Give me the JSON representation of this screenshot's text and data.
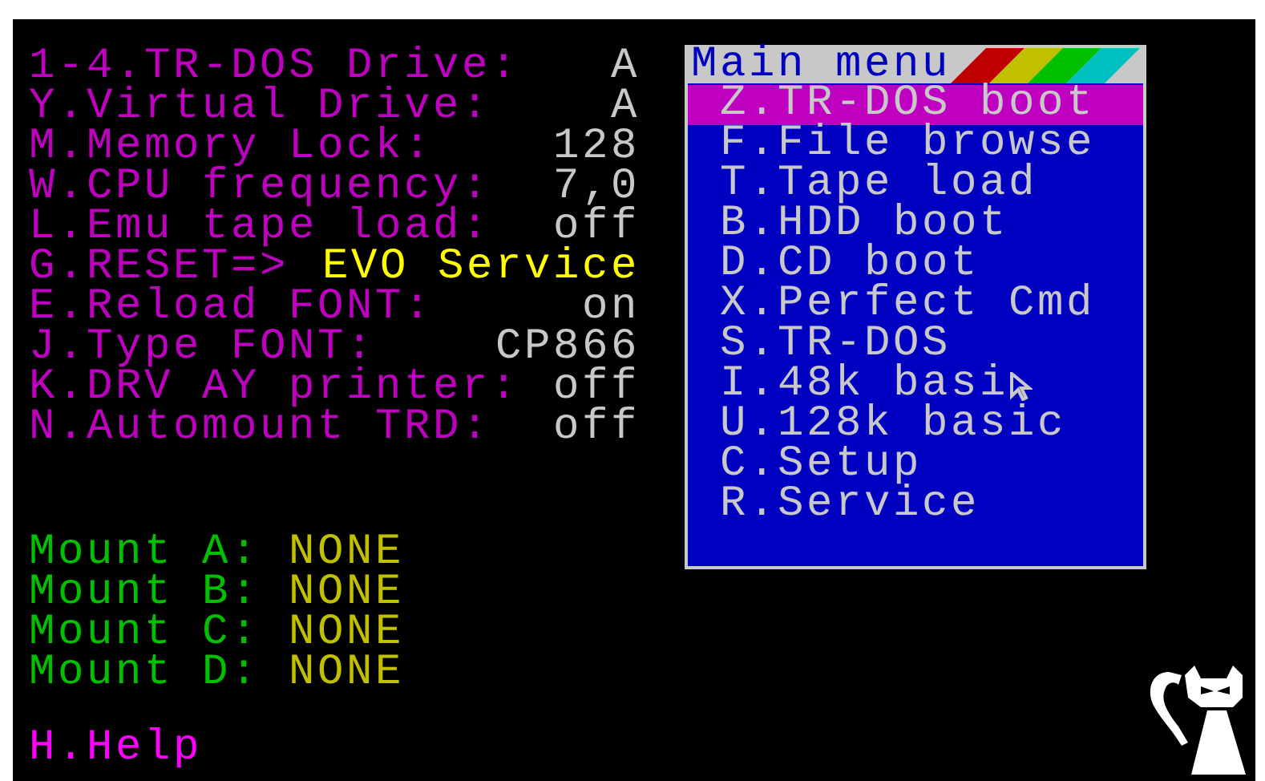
{
  "settings": [
    {
      "label": "1-4.TR-DOS Drive:",
      "value": "A",
      "kind": "value"
    },
    {
      "label": "Y.Virtual Drive:",
      "value": "A",
      "kind": "value"
    },
    {
      "label": "M.Memory Lock:",
      "value": "128",
      "kind": "value"
    },
    {
      "label": "W.CPU frequency:",
      "value": "7,0",
      "kind": "value"
    },
    {
      "label": "L.Emu tape load:",
      "value": "off",
      "kind": "value"
    },
    {
      "label": "G.RESET=>",
      "value": "EVO Service",
      "kind": "action"
    },
    {
      "label": "E.Reload FONT:",
      "value": "on",
      "kind": "value"
    },
    {
      "label": "J.Type FONT:",
      "value": "CP866",
      "kind": "value"
    },
    {
      "label": "K.DRV AY printer:",
      "value": "off",
      "kind": "value"
    },
    {
      "label": "N.Automount TRD:",
      "value": "off",
      "kind": "value"
    }
  ],
  "mounts": [
    {
      "label": "Mount A:",
      "value": "NONE"
    },
    {
      "label": "Mount B:",
      "value": "NONE"
    },
    {
      "label": "Mount C:",
      "value": "NONE"
    },
    {
      "label": "Mount D:",
      "value": "NONE"
    }
  ],
  "help": "H.Help",
  "menu": {
    "title": "Main menu",
    "items": [
      {
        "label": "Z.TR-DOS boot",
        "selected": true,
        "pointer": false
      },
      {
        "label": "F.File browse",
        "selected": false,
        "pointer": false
      },
      {
        "label": "T.Tape load",
        "selected": false,
        "pointer": false
      },
      {
        "label": "B.HDD boot",
        "selected": false,
        "pointer": false
      },
      {
        "label": "D.CD boot",
        "selected": false,
        "pointer": false
      },
      {
        "label": "X.Perfect Cmd",
        "selected": false,
        "pointer": false
      },
      {
        "label": "S.TR-DOS",
        "selected": false,
        "pointer": false
      },
      {
        "label": "I.48k basi",
        "selected": false,
        "pointer": true
      },
      {
        "label": "U.128k basic",
        "selected": false,
        "pointer": false
      },
      {
        "label": "C.Setup",
        "selected": false,
        "pointer": false
      },
      {
        "label": "R.Service",
        "selected": false,
        "pointer": false
      }
    ]
  }
}
